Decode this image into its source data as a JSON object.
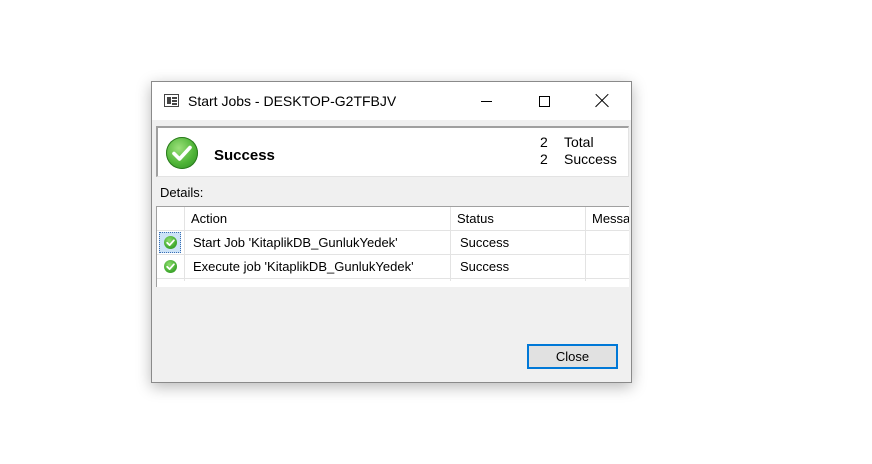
{
  "window": {
    "title": "Start Jobs - DESKTOP-G2TFBJV",
    "minimize_icon": "minimize-icon",
    "maximize_icon": "maximize-icon",
    "close_icon": "close-icon"
  },
  "summary": {
    "status": "Success",
    "total_count": "2",
    "total_label": "Total",
    "success_count": "2",
    "success_label": "Success",
    "icon": "success-check-icon"
  },
  "details": {
    "label": "Details:",
    "columns": [
      "Action",
      "Status",
      "Messa"
    ],
    "rows": [
      {
        "action": "Start Job 'KitaplikDB_GunlukYedek'",
        "status": "Success",
        "message": ""
      },
      {
        "action": "Execute job 'KitaplikDB_GunlukYedek'",
        "status": "Success",
        "message": ""
      }
    ]
  },
  "buttons": {
    "close_label": "Close"
  },
  "colors": {
    "accent": "#0078d7",
    "success_green": "#4fb437"
  }
}
